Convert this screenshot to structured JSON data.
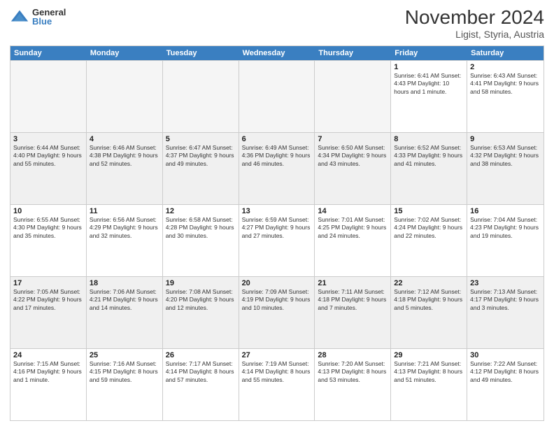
{
  "logo": {
    "general": "General",
    "blue": "Blue"
  },
  "title": "November 2024",
  "subtitle": "Ligist, Styria, Austria",
  "days": [
    "Sunday",
    "Monday",
    "Tuesday",
    "Wednesday",
    "Thursday",
    "Friday",
    "Saturday"
  ],
  "weeks": [
    [
      {
        "day": "",
        "info": "",
        "empty": true
      },
      {
        "day": "",
        "info": "",
        "empty": true
      },
      {
        "day": "",
        "info": "",
        "empty": true
      },
      {
        "day": "",
        "info": "",
        "empty": true
      },
      {
        "day": "",
        "info": "",
        "empty": true
      },
      {
        "day": "1",
        "info": "Sunrise: 6:41 AM\nSunset: 4:43 PM\nDaylight: 10 hours\nand 1 minute."
      },
      {
        "day": "2",
        "info": "Sunrise: 6:43 AM\nSunset: 4:41 PM\nDaylight: 9 hours\nand 58 minutes."
      }
    ],
    [
      {
        "day": "3",
        "info": "Sunrise: 6:44 AM\nSunset: 4:40 PM\nDaylight: 9 hours\nand 55 minutes."
      },
      {
        "day": "4",
        "info": "Sunrise: 6:46 AM\nSunset: 4:38 PM\nDaylight: 9 hours\nand 52 minutes."
      },
      {
        "day": "5",
        "info": "Sunrise: 6:47 AM\nSunset: 4:37 PM\nDaylight: 9 hours\nand 49 minutes."
      },
      {
        "day": "6",
        "info": "Sunrise: 6:49 AM\nSunset: 4:36 PM\nDaylight: 9 hours\nand 46 minutes."
      },
      {
        "day": "7",
        "info": "Sunrise: 6:50 AM\nSunset: 4:34 PM\nDaylight: 9 hours\nand 43 minutes."
      },
      {
        "day": "8",
        "info": "Sunrise: 6:52 AM\nSunset: 4:33 PM\nDaylight: 9 hours\nand 41 minutes."
      },
      {
        "day": "9",
        "info": "Sunrise: 6:53 AM\nSunset: 4:32 PM\nDaylight: 9 hours\nand 38 minutes."
      }
    ],
    [
      {
        "day": "10",
        "info": "Sunrise: 6:55 AM\nSunset: 4:30 PM\nDaylight: 9 hours\nand 35 minutes."
      },
      {
        "day": "11",
        "info": "Sunrise: 6:56 AM\nSunset: 4:29 PM\nDaylight: 9 hours\nand 32 minutes."
      },
      {
        "day": "12",
        "info": "Sunrise: 6:58 AM\nSunset: 4:28 PM\nDaylight: 9 hours\nand 30 minutes."
      },
      {
        "day": "13",
        "info": "Sunrise: 6:59 AM\nSunset: 4:27 PM\nDaylight: 9 hours\nand 27 minutes."
      },
      {
        "day": "14",
        "info": "Sunrise: 7:01 AM\nSunset: 4:25 PM\nDaylight: 9 hours\nand 24 minutes."
      },
      {
        "day": "15",
        "info": "Sunrise: 7:02 AM\nSunset: 4:24 PM\nDaylight: 9 hours\nand 22 minutes."
      },
      {
        "day": "16",
        "info": "Sunrise: 7:04 AM\nSunset: 4:23 PM\nDaylight: 9 hours\nand 19 minutes."
      }
    ],
    [
      {
        "day": "17",
        "info": "Sunrise: 7:05 AM\nSunset: 4:22 PM\nDaylight: 9 hours\nand 17 minutes."
      },
      {
        "day": "18",
        "info": "Sunrise: 7:06 AM\nSunset: 4:21 PM\nDaylight: 9 hours\nand 14 minutes."
      },
      {
        "day": "19",
        "info": "Sunrise: 7:08 AM\nSunset: 4:20 PM\nDaylight: 9 hours\nand 12 minutes."
      },
      {
        "day": "20",
        "info": "Sunrise: 7:09 AM\nSunset: 4:19 PM\nDaylight: 9 hours\nand 10 minutes."
      },
      {
        "day": "21",
        "info": "Sunrise: 7:11 AM\nSunset: 4:18 PM\nDaylight: 9 hours\nand 7 minutes."
      },
      {
        "day": "22",
        "info": "Sunrise: 7:12 AM\nSunset: 4:18 PM\nDaylight: 9 hours\nand 5 minutes."
      },
      {
        "day": "23",
        "info": "Sunrise: 7:13 AM\nSunset: 4:17 PM\nDaylight: 9 hours\nand 3 minutes."
      }
    ],
    [
      {
        "day": "24",
        "info": "Sunrise: 7:15 AM\nSunset: 4:16 PM\nDaylight: 9 hours\nand 1 minute."
      },
      {
        "day": "25",
        "info": "Sunrise: 7:16 AM\nSunset: 4:15 PM\nDaylight: 8 hours\nand 59 minutes."
      },
      {
        "day": "26",
        "info": "Sunrise: 7:17 AM\nSunset: 4:14 PM\nDaylight: 8 hours\nand 57 minutes."
      },
      {
        "day": "27",
        "info": "Sunrise: 7:19 AM\nSunset: 4:14 PM\nDaylight: 8 hours\nand 55 minutes."
      },
      {
        "day": "28",
        "info": "Sunrise: 7:20 AM\nSunset: 4:13 PM\nDaylight: 8 hours\nand 53 minutes."
      },
      {
        "day": "29",
        "info": "Sunrise: 7:21 AM\nSunset: 4:13 PM\nDaylight: 8 hours\nand 51 minutes."
      },
      {
        "day": "30",
        "info": "Sunrise: 7:22 AM\nSunset: 4:12 PM\nDaylight: 8 hours\nand 49 minutes."
      }
    ]
  ]
}
